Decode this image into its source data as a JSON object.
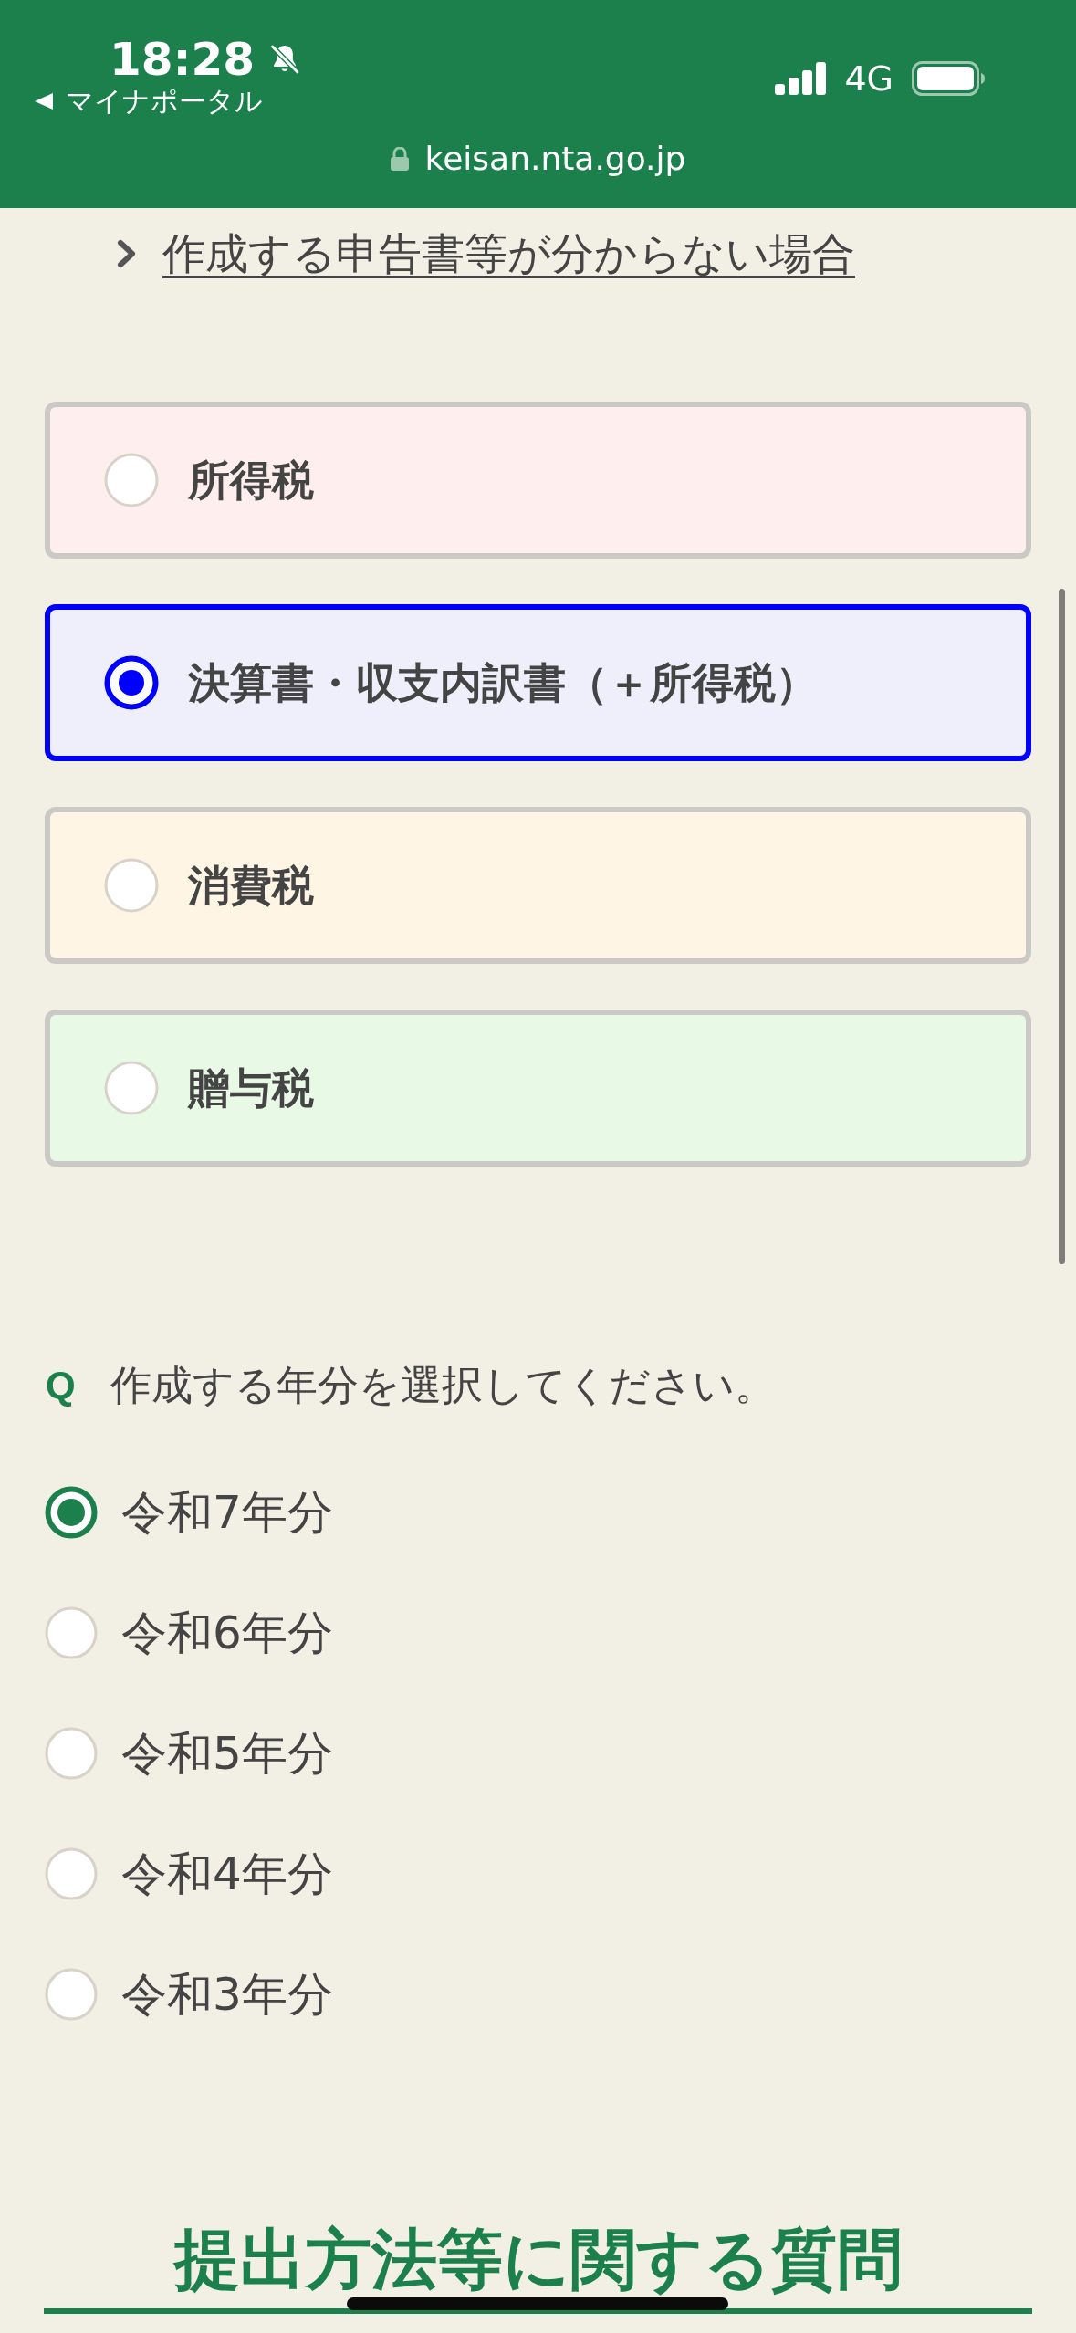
{
  "status_bar": {
    "time": "18:28",
    "back_app": "マイナポータル",
    "network": "4G"
  },
  "url_bar": {
    "url": "keisan.nta.go.jp"
  },
  "help_link": {
    "label": "作成する申告書等が分からない場合"
  },
  "tax_options": [
    {
      "label": "所得税",
      "selected": false,
      "color": "#ffeeee"
    },
    {
      "label": "決算書・収支内訳書（＋所得税）",
      "selected": true,
      "color": "#efeffc"
    },
    {
      "label": "消費税",
      "selected": false,
      "color": "#fff5e5"
    },
    {
      "label": "贈与税",
      "selected": false,
      "color": "#e8f9e6"
    }
  ],
  "question": {
    "marker": "Q",
    "text": "作成する年分を選択してください。"
  },
  "year_options": [
    {
      "label": "令和7年分",
      "selected": true
    },
    {
      "label": "令和6年分",
      "selected": false
    },
    {
      "label": "令和5年分",
      "selected": false
    },
    {
      "label": "令和4年分",
      "selected": false
    },
    {
      "label": "令和3年分",
      "selected": false
    }
  ],
  "section_heading": {
    "title": "提出方法等に関する質問"
  }
}
